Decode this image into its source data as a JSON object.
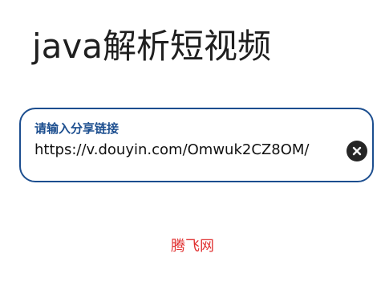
{
  "header": {
    "title": "java解析短视频"
  },
  "url_input": {
    "label": "请输入分享链接",
    "value": "https://v.douyin.com/Omwuk2CZ8OM/",
    "clear_icon": "close-icon"
  },
  "footer": {
    "text": "腾飞网"
  },
  "colors": {
    "accent": "#1c4e8f",
    "footer_text": "#e03030",
    "title_text": "#1f1f1f"
  }
}
